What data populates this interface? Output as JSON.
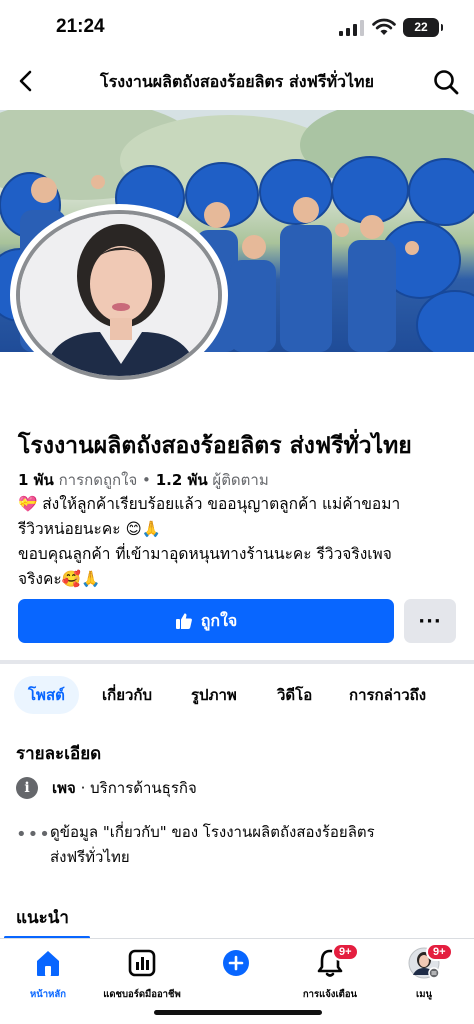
{
  "status_bar": {
    "time": "21:24",
    "battery": "22"
  },
  "nav": {
    "title": "โรงงานผลิตถังสองร้อยลิตร ส่งฟรีทั่วไทย"
  },
  "page": {
    "name": "โรงงานผลิตถังสองร้อยลิตร ส่งฟรีทั่วไทย",
    "likes_count": "1 พัน",
    "likes_label": "การกดถูกใจ",
    "separator": "•",
    "followers_count": "1.2 พัน",
    "followers_label": "ผู้ติดตาม",
    "bio_lines": [
      "💝 ส่งให้ลูกค้าเรียบร้อยแล้ว ขออนุญาตลูกค้า แม่ค้าขอมา",
      "รีวิวหน่อยนะคะ 😊🙏",
      "ขอบคุณลูกค้า ที่เข้ามาอุดหนุนทางร้านนะคะ รีวิวจริงเพจ",
      "จริงคะ🥰🙏"
    ]
  },
  "actions": {
    "like_label": "ถูกใจ",
    "more_label": "···"
  },
  "tabs": [
    "โพสต์",
    "เกี่ยวกับ",
    "รูปภาพ",
    "วิดีโอ",
    "การกล่าวถึง"
  ],
  "details": {
    "title": "รายละเอียด",
    "category_prefix": "เพจ",
    "category": " · บริการด้านธุรกิจ",
    "about_lines": [
      "ดูข้อมูล \"เกี่ยวกับ\" ของ โรงงานผลิตถังสองร้อยลิตร",
      "ส่งฟรีทั่วไทย"
    ]
  },
  "recommend_title": "แนะนำ",
  "bottom_nav": {
    "items": [
      {
        "label": "หน้าหลัก",
        "icon": "home-icon"
      },
      {
        "label": "แดชบอร์ดมืออาชีพ",
        "icon": "dashboard-icon"
      },
      {
        "label": "",
        "icon": "create-icon"
      },
      {
        "label": "การแจ้งเตือน",
        "icon": "bell-icon",
        "badge": "9+"
      },
      {
        "label": "เมนู",
        "icon": "avatar-icon",
        "badge": "9+"
      }
    ]
  },
  "colors": {
    "accent": "#0866ff",
    "badge": "#e41e3f"
  }
}
